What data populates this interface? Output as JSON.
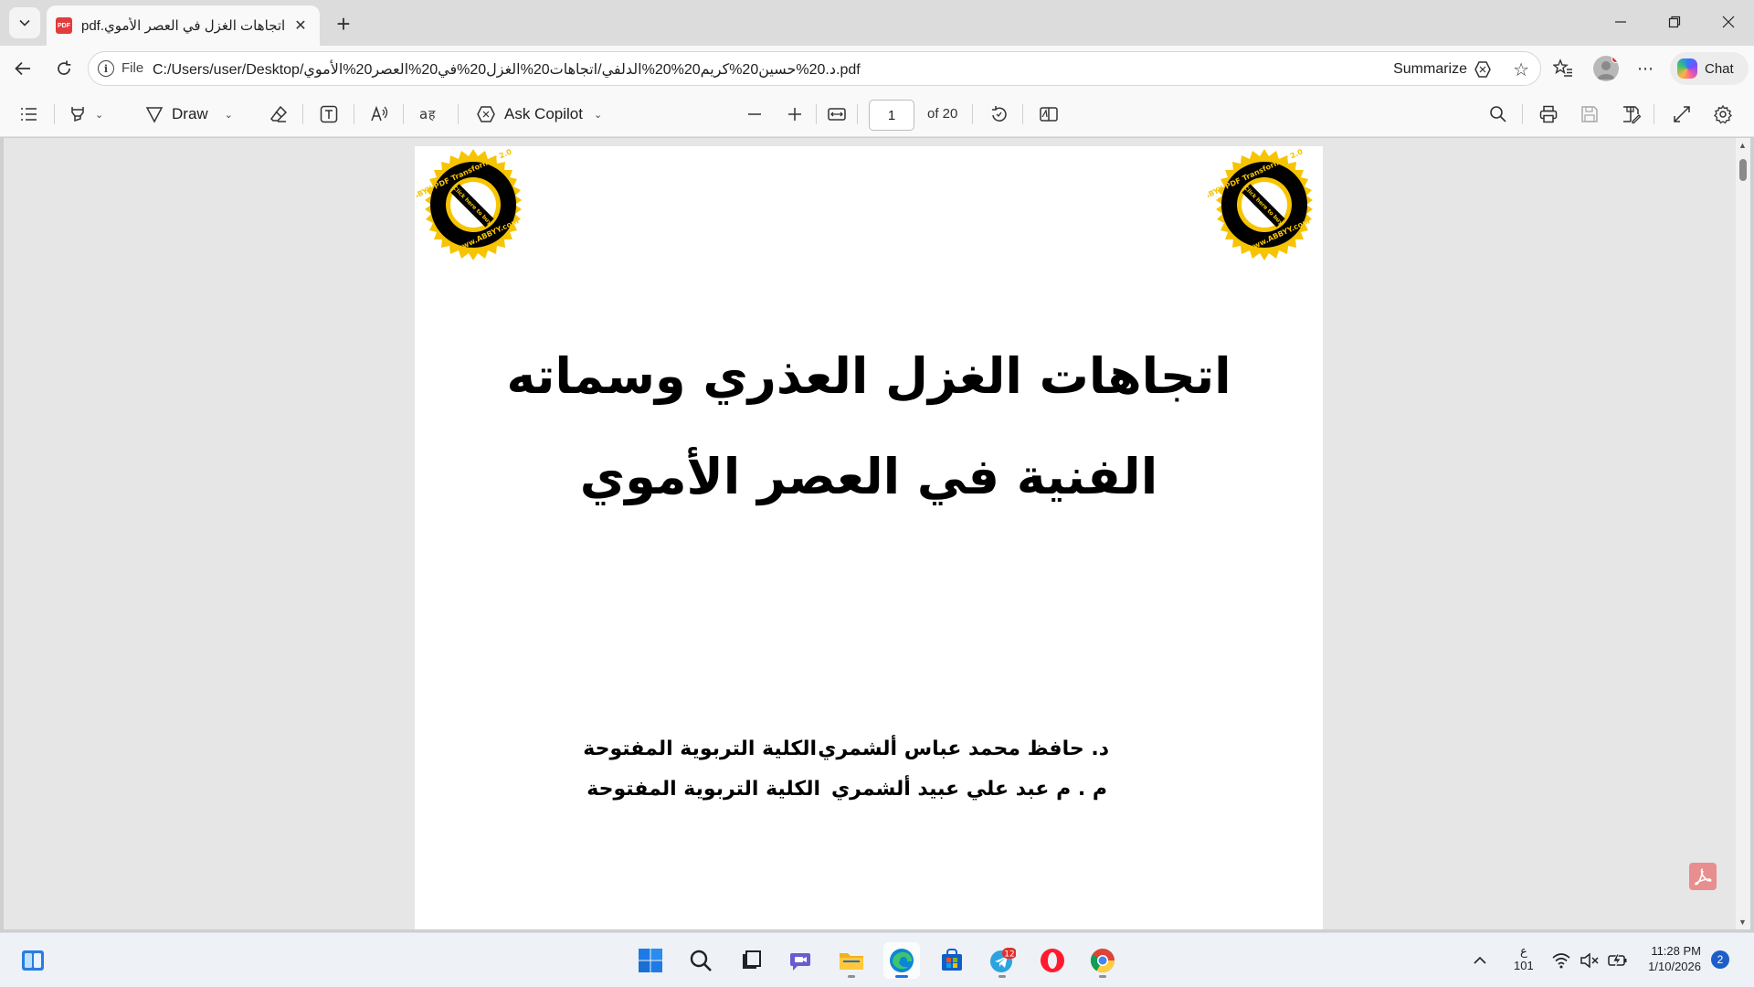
{
  "browser": {
    "tab": {
      "title": "اتجاهات الغزل في العصر الأموي.pdf",
      "favicon_text": "PDF"
    },
    "address": {
      "scheme_label": "File",
      "url": "C:/Users/user/Desktop/د.20%حسين20%كريم20%20%الدلفي/اتجاهات20%الغزل20%في20%العصر20%الأموي.pdf",
      "summarize_label": "Summarize"
    },
    "chat_label": "Chat"
  },
  "pdf_toolbar": {
    "draw_label": "Draw",
    "ask_copilot_label": "Ask Copilot",
    "page_number": "1",
    "page_count_label": "of 20"
  },
  "document": {
    "stamp_text": "ABBYY PDF Transformer 2.0",
    "stamp_inner_text": "Click here to buy",
    "stamp_url": "www.ABBYY.com",
    "title_line1": "اتجاهات الغزل العذري وسماته",
    "title_line2": "الفنية في العصر الأموي",
    "authors": [
      {
        "name": "د. حافظ محمد عباس ألشمري",
        "affiliation": "الكلية التربوية المفتوحة"
      },
      {
        "name": "م . م  عبد علي عبيد ألشمري",
        "affiliation": "الكلية التربوية المفتوحة"
      }
    ]
  },
  "taskbar": {
    "telegram_badge": "12",
    "tray_lang_top": "ع",
    "tray_lang_bottom": "101",
    "clock_time": "11:28 PM",
    "clock_date": "1/10/2026",
    "notification_count": "2"
  },
  "colors": {
    "edge_accent": "#1a73e8",
    "pdf_red": "#e23c3c",
    "stamp_yellow": "#f6c400"
  }
}
